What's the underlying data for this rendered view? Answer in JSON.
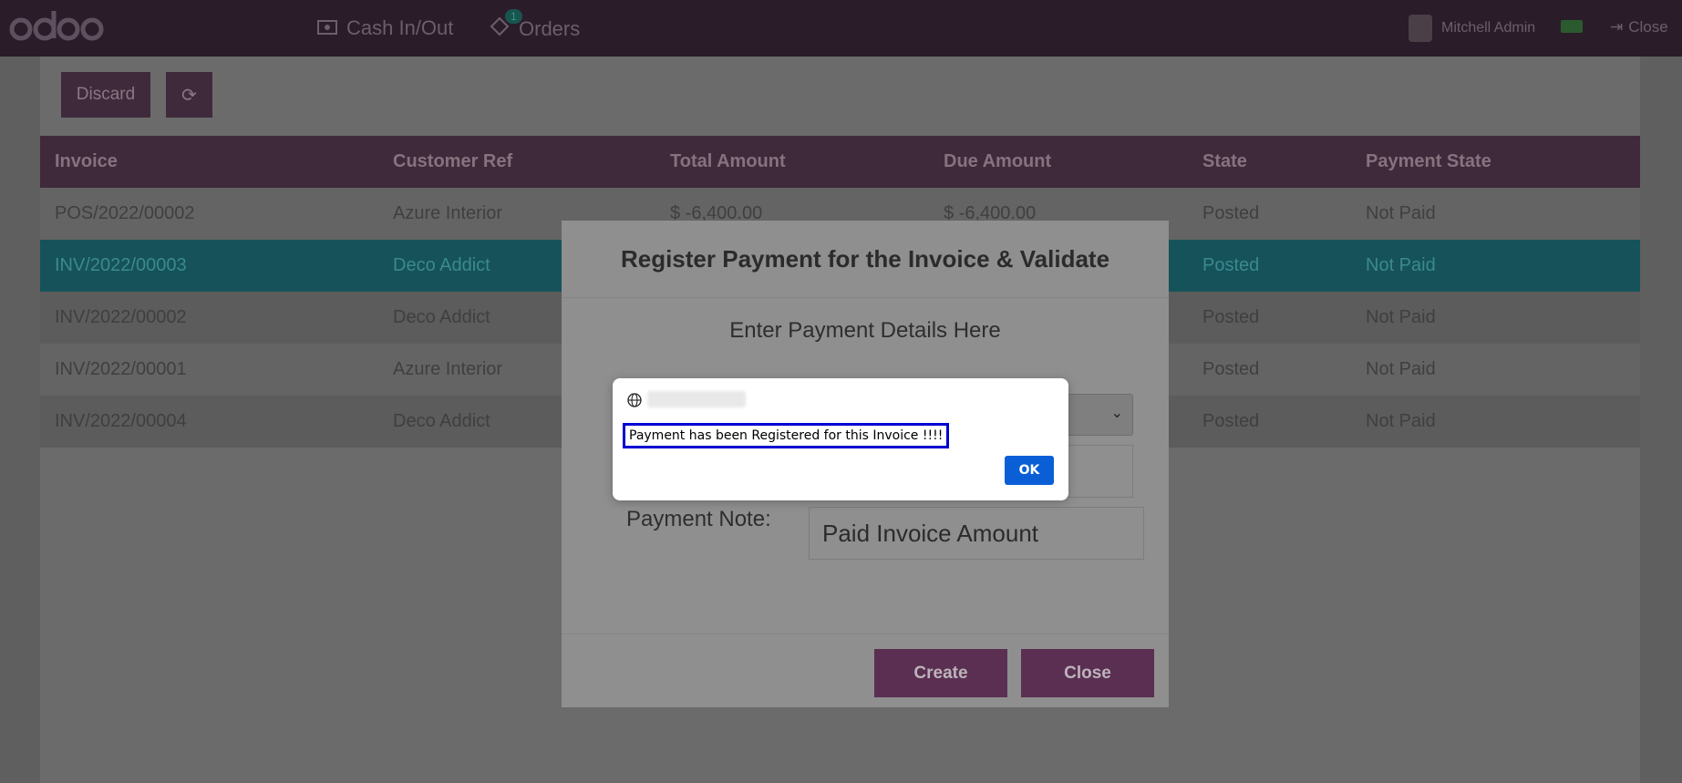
{
  "topbar": {
    "logo_text": "odoo",
    "cash_in_out": "Cash In/Out",
    "orders": "Orders",
    "orders_badge": "1",
    "user_name": "Mitchell Admin",
    "close": "Close"
  },
  "toolbar": {
    "discard": "Discard",
    "refresh_icon": "refresh-icon"
  },
  "table": {
    "headers": [
      "Invoice",
      "Customer Ref",
      "Total Amount",
      "Due Amount",
      "State",
      "Payment State"
    ],
    "rows": [
      {
        "invoice": "POS/2022/00002",
        "customer": "Azure Interior",
        "total": "$ -6,400.00",
        "due": "$ -6,400.00",
        "state": "Posted",
        "payment_state": "Not Paid"
      },
      {
        "invoice": "INV/2022/00003",
        "customer": "Deco Addict",
        "total": "",
        "due": "",
        "state": "Posted",
        "payment_state": "Not Paid"
      },
      {
        "invoice": "INV/2022/00002",
        "customer": "Deco Addict",
        "total": "",
        "due": "",
        "state": "Posted",
        "payment_state": "Not Paid"
      },
      {
        "invoice": "INV/2022/00001",
        "customer": "Azure Interior",
        "total": "",
        "due": "",
        "state": "Posted",
        "payment_state": "Not Paid"
      },
      {
        "invoice": "INV/2022/00004",
        "customer": "Deco Addict",
        "total": "",
        "due": "",
        "state": "Posted",
        "payment_state": "Not Paid"
      }
    ]
  },
  "modal": {
    "title": "Register Payment for the Invoice & Validate",
    "subtitle": "Enter Payment Details Here",
    "note_label": "Payment Note:",
    "note_value": "Paid Invoice Amount",
    "create": "Create",
    "close": "Close"
  },
  "alert": {
    "message": "Payment has been Registered for this Invoice !!!!",
    "ok": "OK"
  },
  "colors": {
    "brand": "#714b67",
    "selected_row": "#17a2b8",
    "ok_button": "#0b5fd6"
  }
}
